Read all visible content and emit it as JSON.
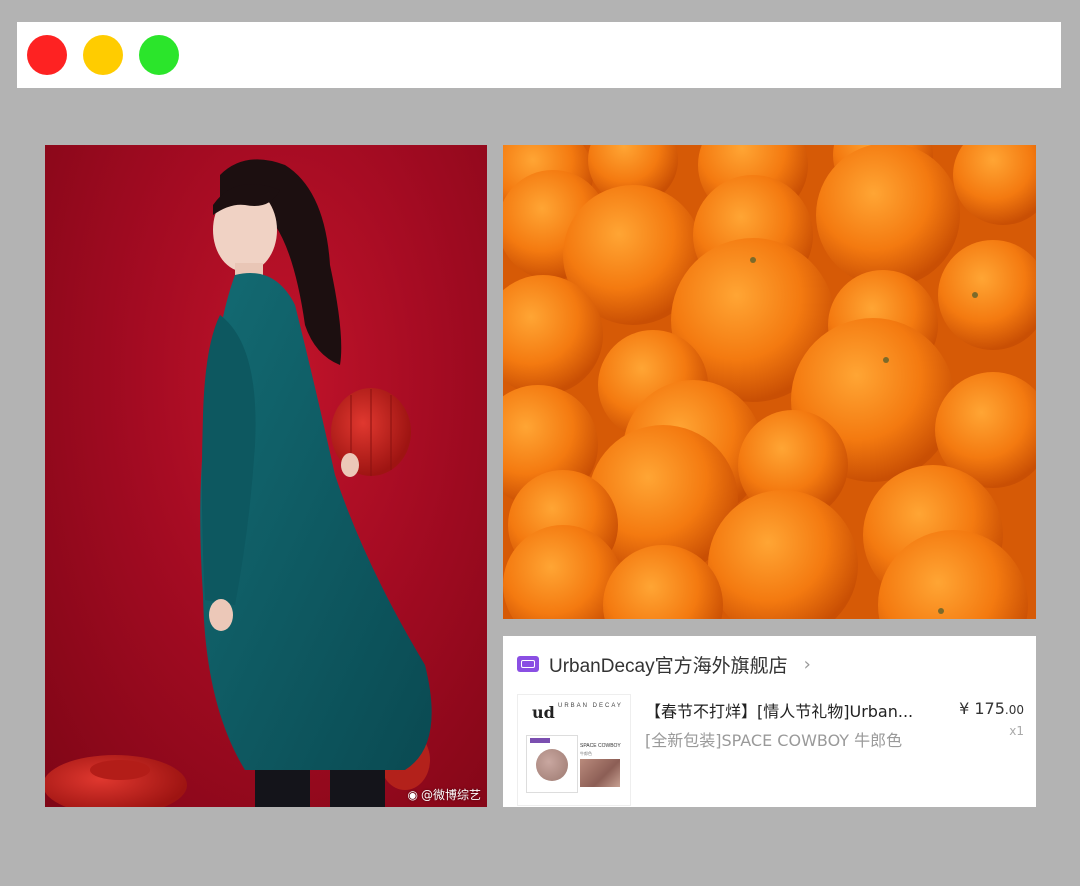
{
  "window": {
    "controls": [
      "close",
      "minimize",
      "maximize"
    ],
    "colors": {
      "close": "#fe2222",
      "minimize": "#ffcc00",
      "maximize": "#2be52b"
    }
  },
  "left_photo": {
    "watermark": "@微博综艺",
    "watermark_icon": "weibo-icon",
    "dominant_colors": [
      "#a30b22",
      "#0f5c64"
    ]
  },
  "right_photo": {
    "dominant_colors": [
      "#f07a10",
      "#d65a06"
    ]
  },
  "order": {
    "store_icon": "tmall-store-icon",
    "store_name": "UrbanDecay官方海外旗舰店",
    "chevron": "›",
    "product_title": "【春节不打烊】[情人节礼物]Urban...",
    "product_spec": "[全新包装]SPACE COWBOY 牛郎色",
    "price_symbol": "¥",
    "price_integer": "175",
    "price_decimal": ".00",
    "quantity": "x1",
    "thumbnail": {
      "brand_mark": "ud",
      "brand_text": "URBAN DECAY",
      "shade_label": "SPACE COWBOY",
      "shade_sub": "牛郎色"
    }
  }
}
